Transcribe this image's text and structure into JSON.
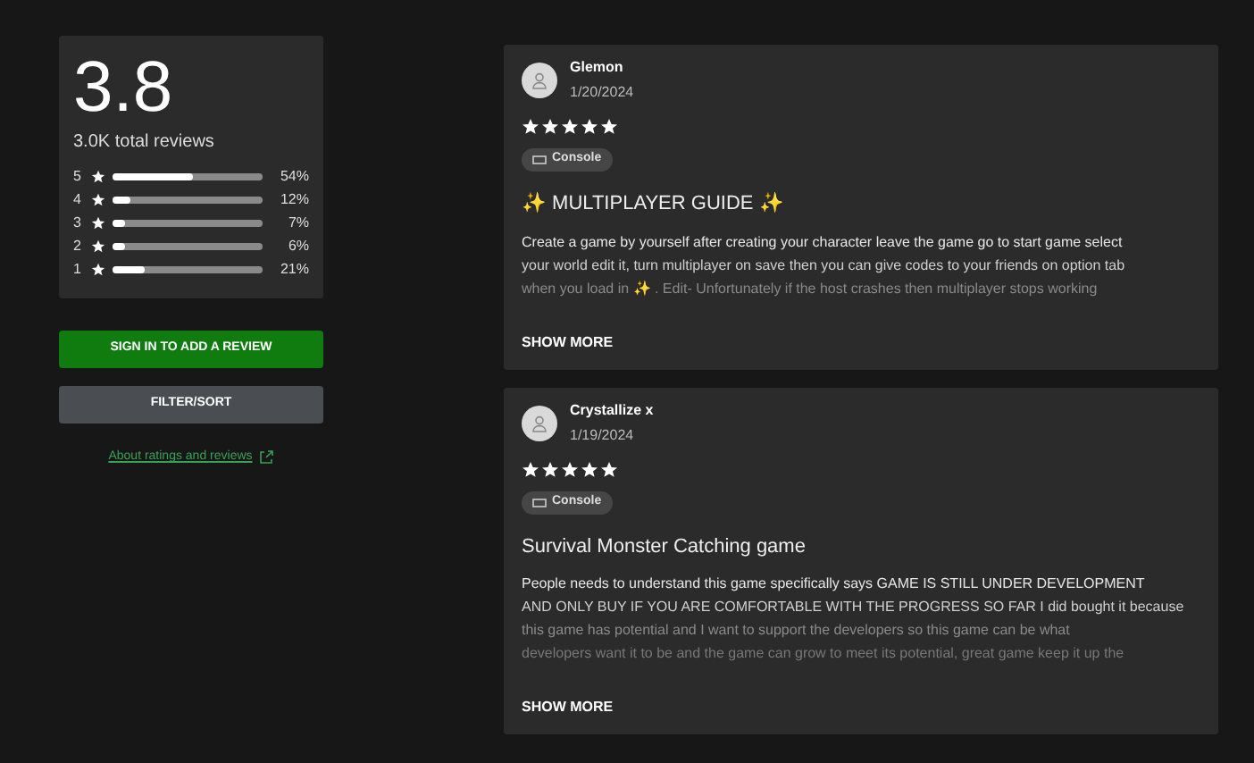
{
  "summary": {
    "rating": "3.8",
    "total": "3.0K total reviews",
    "bars": [
      {
        "stars": "5",
        "level": 0.54,
        "percent": "54%"
      },
      {
        "stars": "4",
        "level": 0.12,
        "percent": "12%"
      },
      {
        "stars": "3",
        "level": 0.07,
        "percent": "7%"
      },
      {
        "stars": "2",
        "level": 0.06,
        "percent": "6%"
      },
      {
        "stars": "1",
        "level": 0.21,
        "percent": "21%"
      }
    ]
  },
  "buttons": [
    "SIGN IN TO ADD A REVIEW",
    "FILTER/SORT"
  ],
  "link": "About ratings and reviews",
  "reviews": [
    {
      "author": "Glemon",
      "date": "1/20/2024",
      "stars": 5,
      "platform": "Console",
      "title": "✨ MULTIPLAYER GUIDE ✨",
      "lines": [
        "Create a game by yourself after creating your character leave the game go to start game select",
        "your world edit it, turn multiplayer on save then you can give codes to your friends on option tab",
        "when you load in ✨ .          Edit- Unfortunately if the host crashes then multiplayer stops working"
      ],
      "more": "SHOW MORE"
    },
    {
      "author": "Crystallize x",
      "date": "1/19/2024",
      "stars": 5,
      "platform": "Console",
      "title": "Survival Monster Catching game",
      "lines": [
        "People needs to understand this game specifically says GAME IS STILL UNDER DEVELOPMENT",
        "AND ONLY BUY IF YOU ARE COMFORTABLE WITH THE PROGRESS SO FAR I did bought it because",
        "this game has potential and I want to support the developers so this game can be what",
        "developers want it to be and the game can grow to meet its potential, great game keep it up the"
      ],
      "more": "SHOW MORE"
    }
  ]
}
